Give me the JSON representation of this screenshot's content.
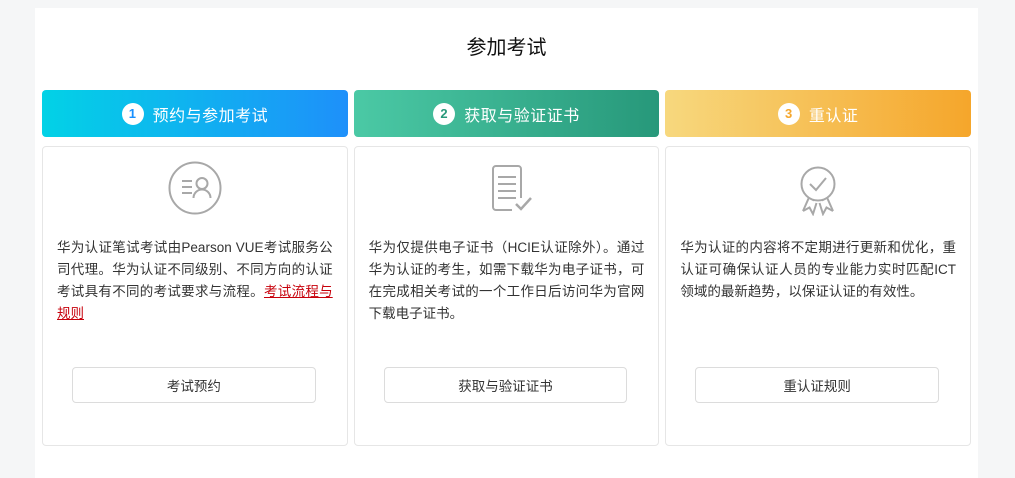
{
  "page": {
    "title": "参加考试",
    "background_color": "#f5f6f7",
    "link_color": "#c7000b"
  },
  "columns": [
    {
      "step_number": "1",
      "step_label": "预约与参加考试",
      "gradient_start": "#02d2e6",
      "gradient_end": "#1e90fa",
      "accent_color": "#1890ff",
      "icon": "profile-list-circle-icon",
      "description": "华为认证笔试考试由Pearson VUE考试服务公司代理。华为认证不同级别、不同方向的认证考试具有不同的考试要求与流程。",
      "link_text": "考试流程与规则",
      "button_label": "考试预约"
    },
    {
      "step_number": "2",
      "step_label": "获取与验证证书",
      "gradient_start": "#4bc9a5",
      "gradient_end": "#27987a",
      "accent_color": "#28997b",
      "icon": "document-check-icon",
      "description": "华为仅提供电子证书（HCIE认证除外）。通过华为认证的考生，如需下载华为电子证书，可在完成相关考试的一个工作日后访问华为官网下载电子证书。",
      "button_label": "获取与验证证书"
    },
    {
      "step_number": "3",
      "step_label": "重认证",
      "gradient_start": "#f7d87e",
      "gradient_end": "#f5a62b",
      "accent_color": "#f5a62b",
      "icon": "medal-check-icon",
      "description": "华为认证的内容将不定期进行更新和优化，重认证可确保认证人员的专业能力实时匹配ICT领域的最新趋势，以保证认证的有效性。",
      "button_label": "重认证规则"
    }
  ]
}
